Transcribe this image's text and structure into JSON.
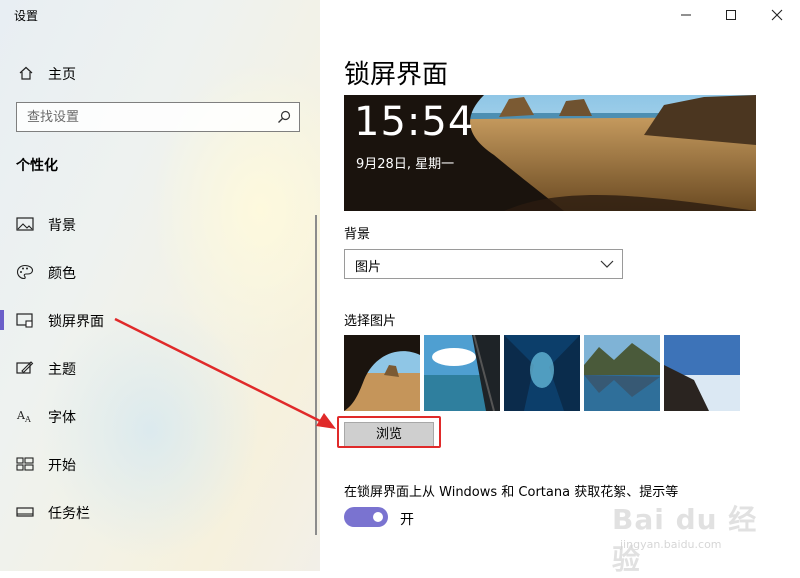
{
  "app": {
    "title": "设置"
  },
  "window_controls": {
    "minimize": "—",
    "maximize": "☐",
    "close": "✕"
  },
  "sidebar": {
    "home_label": "主页",
    "search_placeholder": "查找设置",
    "section_title": "个性化",
    "items": [
      {
        "label": "背景",
        "icon": "image-icon"
      },
      {
        "label": "颜色",
        "icon": "palette-icon"
      },
      {
        "label": "锁屏界面",
        "icon": "lock-screen-icon",
        "active": true
      },
      {
        "label": "主题",
        "icon": "theme-icon"
      },
      {
        "label": "字体",
        "icon": "font-icon"
      },
      {
        "label": "开始",
        "icon": "start-icon"
      },
      {
        "label": "任务栏",
        "icon": "taskbar-icon"
      }
    ]
  },
  "main": {
    "title": "锁屏界面",
    "preview": {
      "time": "15:54",
      "date": "9月28日, 星期一"
    },
    "background_label": "背景",
    "background_value": "图片",
    "choose_label": "选择图片",
    "browse_label": "浏览",
    "tips_label": "在锁屏界面上从 Windows 和 Cortana 获取花絮、提示等",
    "tips_toggle": {
      "state": "开",
      "on": true
    }
  },
  "colors": {
    "accent": "#7a73d0",
    "annotation": "#e02a2a"
  },
  "watermark": {
    "brand": "Bai du 经验",
    "url": "jingyan.baidu.com"
  }
}
